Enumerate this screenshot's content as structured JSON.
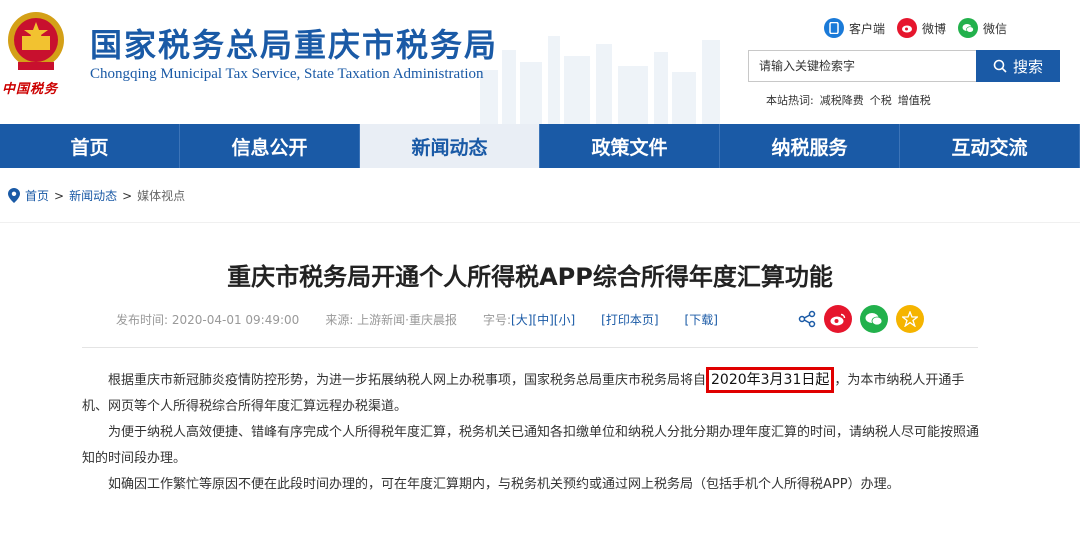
{
  "header": {
    "emblem_caption": "中国税务",
    "title": "国家税务总局重庆市税务局",
    "subtitle": "Chongqing Municipal Tax Service, State Taxation Administration",
    "quick_links": [
      {
        "label": "客户端",
        "icon": "client-app-icon",
        "color": "#1a7ad8"
      },
      {
        "label": "微博",
        "icon": "weibo-icon",
        "color": "#e6162d"
      },
      {
        "label": "微信",
        "icon": "wechat-icon",
        "color": "#22b14c"
      }
    ],
    "search": {
      "placeholder": "请输入关键检索字",
      "button_label": "搜索"
    },
    "hotwords": {
      "prefix": "本站热词:",
      "words": [
        "减税降费",
        "个税",
        "增值税"
      ]
    }
  },
  "nav": {
    "items": [
      {
        "label": "首页",
        "active": false
      },
      {
        "label": "信息公开",
        "active": false
      },
      {
        "label": "新闻动态",
        "active": true
      },
      {
        "label": "政策文件",
        "active": false
      },
      {
        "label": "纳税服务",
        "active": false
      },
      {
        "label": "互动交流",
        "active": false
      }
    ]
  },
  "breadcrumb": {
    "items": [
      "首页",
      "新闻动态",
      "媒体视点"
    ],
    "separator": ">"
  },
  "article": {
    "title": "重庆市税务局开通个人所得税APP综合所得年度汇算功能",
    "meta": {
      "published": "发布时间: 2020-04-01 09:49:00",
      "source": "来源: 上游新闻·重庆晨报",
      "fontsize_label": "字号:",
      "size_large": "[大]",
      "size_medium": "[中]",
      "size_small": "[小]",
      "print_label": "[打印本页]",
      "download_label": "[下载]"
    },
    "share_icons": [
      {
        "name": "share-icon",
        "color": "#1a5aa6"
      },
      {
        "name": "weibo-share-icon",
        "color": "#e6162d"
      },
      {
        "name": "wechat-share-icon",
        "color": "#22b14c"
      },
      {
        "name": "favorite-icon",
        "color": "#f5b400"
      }
    ],
    "paragraphs": {
      "p1_before": "根据重庆市新冠肺炎疫情防控形势，为进一步拓展纳税人网上办税事项，国家税务总局重庆市税务局将自",
      "p1_highlight": "2020年3月31日起",
      "p1_after": "，为本市纳税人开通手机、网页等个人所得税综合所得年度汇算远程办税渠道。",
      "p2": "为便于纳税人高效便捷、错峰有序完成个人所得税年度汇算，税务机关已通知各扣缴单位和纳税人分批分期办理年度汇算的时间，请纳税人尽可能按照通知的时间段办理。",
      "p3": "如确因工作繁忙等原因不便在此段时间办理的，可在年度汇算期内，与税务机关预约或通过网上税务局（包括手机个人所得税APP）办理。"
    }
  }
}
